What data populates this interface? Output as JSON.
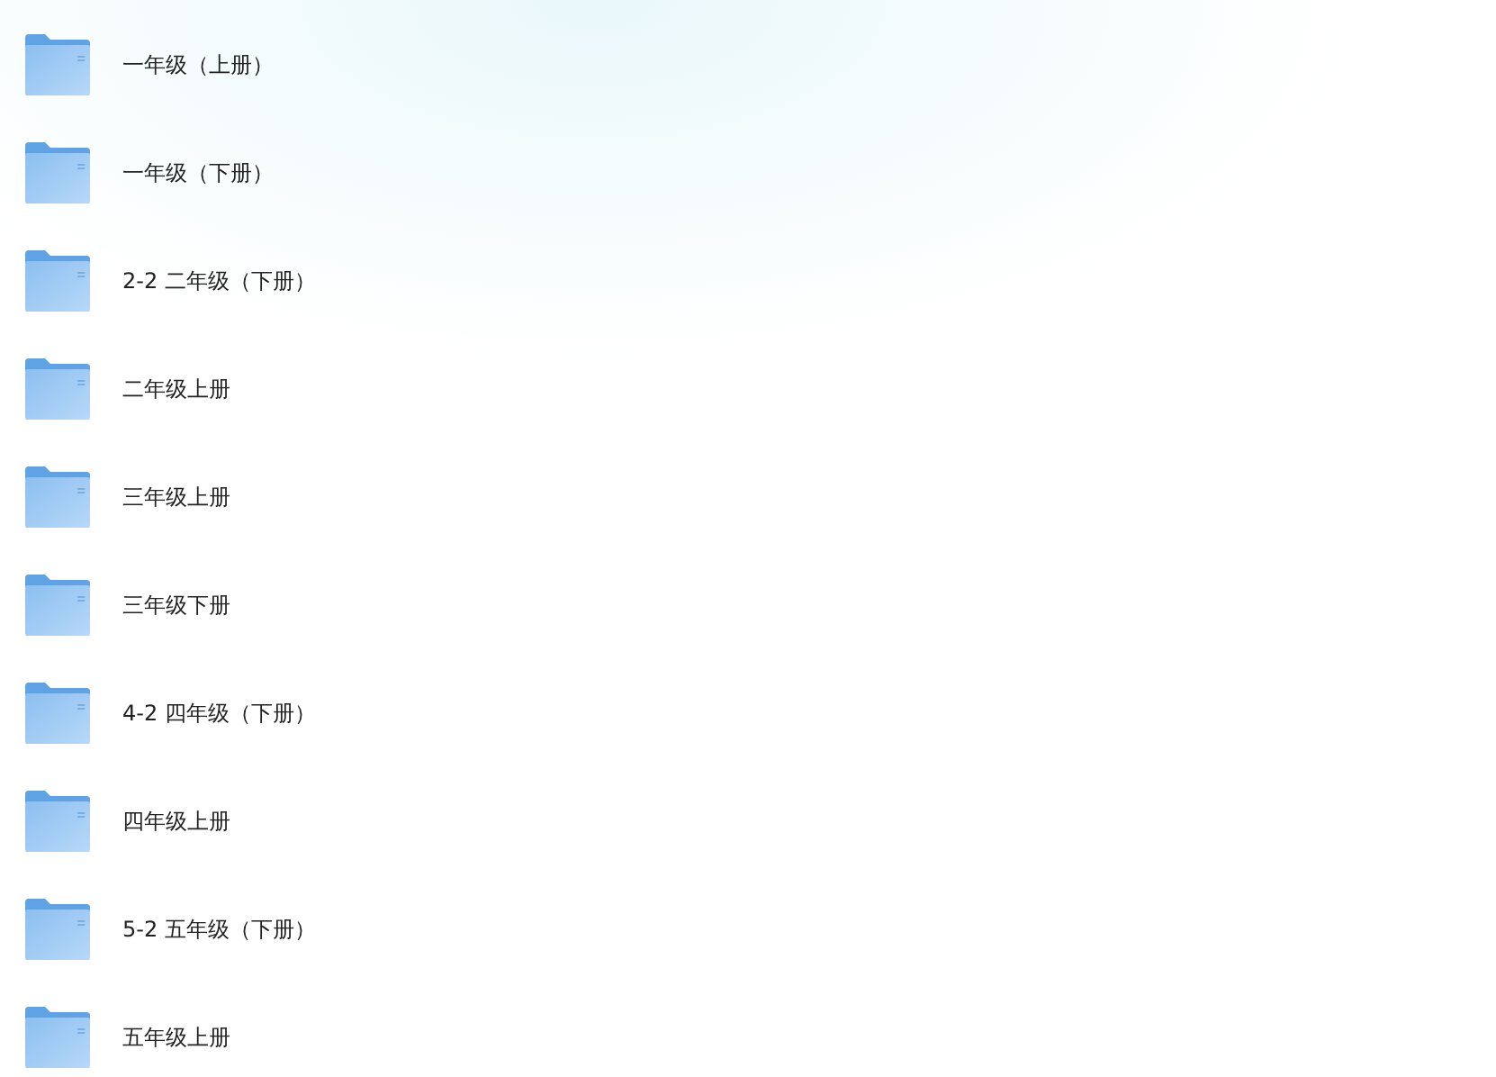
{
  "folders": [
    {
      "name": "一年级（上册）"
    },
    {
      "name": "一年级（下册）"
    },
    {
      "name": "2-2 二年级（下册）"
    },
    {
      "name": "二年级上册"
    },
    {
      "name": "三年级上册"
    },
    {
      "name": "三年级下册"
    },
    {
      "name": "4-2 四年级（下册）"
    },
    {
      "name": "四年级上册"
    },
    {
      "name": "5-2 五年级（下册）"
    },
    {
      "name": "五年级上册"
    }
  ]
}
